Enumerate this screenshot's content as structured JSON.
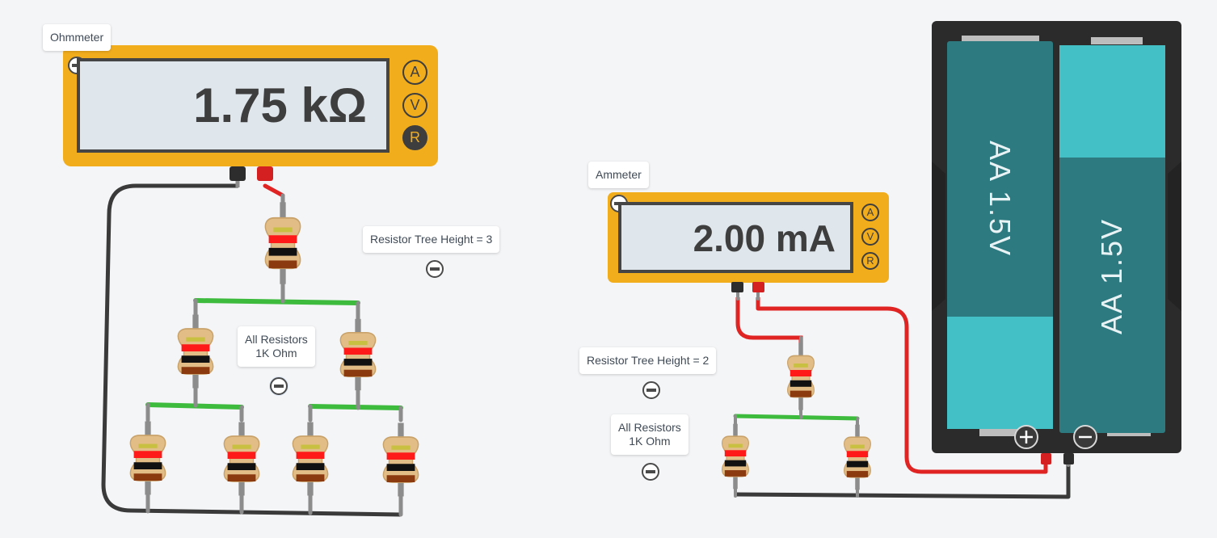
{
  "ohmmeter": {
    "label": "Ohmmeter",
    "reading": "1.75 kΩ",
    "modes": [
      {
        "name": "ammeter-mode",
        "label": "A",
        "active": false
      },
      {
        "name": "voltmeter-mode",
        "label": "V",
        "active": false
      },
      {
        "name": "resistance-mode",
        "label": "R",
        "active": true
      }
    ]
  },
  "ammeter": {
    "label": "Ammeter",
    "reading": "2.00 mA",
    "modes": [
      {
        "name": "ammeter-mode",
        "label": "A",
        "active": false
      },
      {
        "name": "voltmeter-mode",
        "label": "V",
        "active": false
      },
      {
        "name": "resistance-mode",
        "label": "R",
        "active": false
      }
    ]
  },
  "notes": {
    "left_tree": "Resistor Tree Height = 3",
    "left_resistors_line1": "All Resistors",
    "left_resistors_line2": "1K Ohm",
    "right_tree": "Resistor Tree Height = 2",
    "right_resistors_line1": "All Resistors",
    "right_resistors_line2": "1K Ohm"
  },
  "battery": {
    "cell1_label": "AA 1.5V",
    "cell2_label": "AA 1.5V",
    "positive_terminal_icon": "plus-icon",
    "negative_terminal_icon": "minus-icon"
  },
  "icons": {
    "collapse": "minus-circle-icon",
    "mode": "circle-letter-icon"
  },
  "colors": {
    "meter_body": "#f2ad1d",
    "wire_black": "#3a3a3a",
    "wire_red": "#e02424",
    "wire_green": "#3dbb3d",
    "resistor_body": "#e2bd86",
    "battery_case": "#2b2b2b",
    "cell_dark": "#2d7a80",
    "cell_light": "#43bfc6"
  }
}
